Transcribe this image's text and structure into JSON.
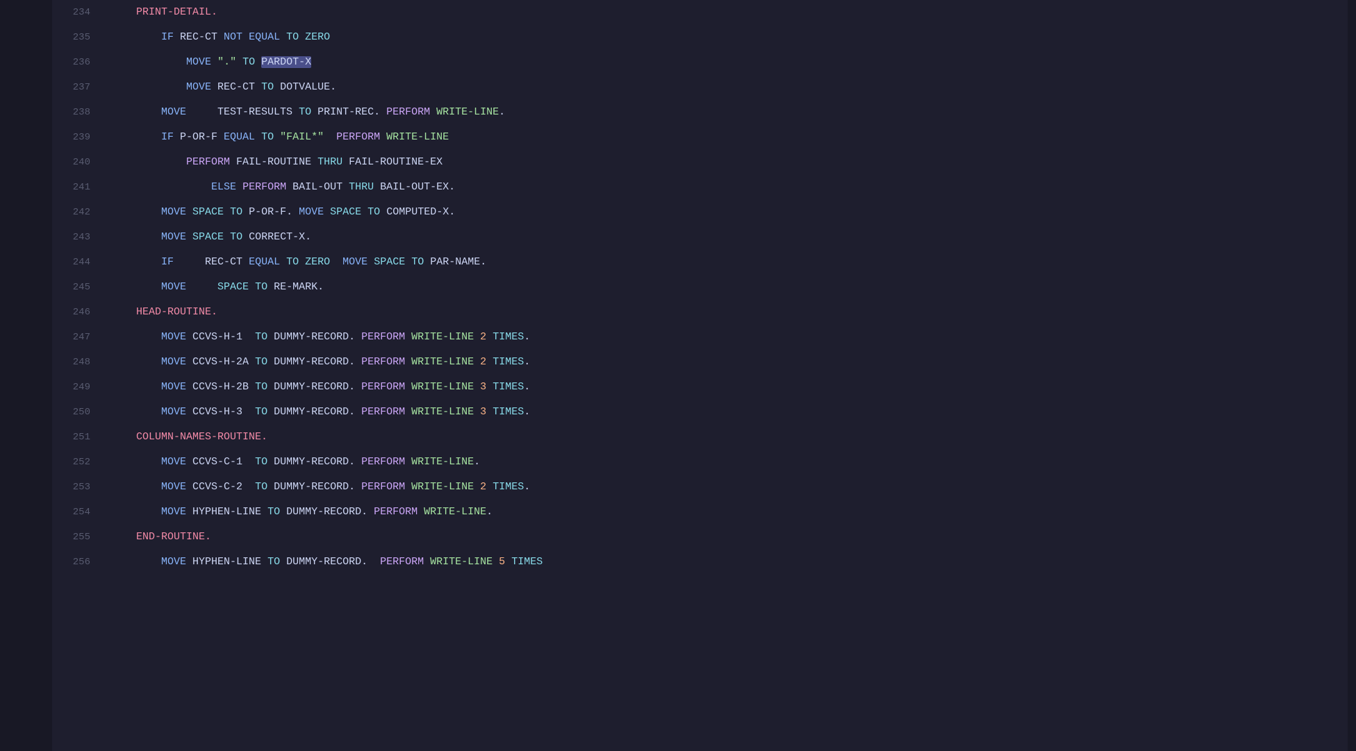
{
  "editor": {
    "background": "#1e1e2e",
    "lines": [
      {
        "number": "234",
        "tokens": [
          {
            "text": "    PRINT-DETAIL.",
            "class": "label"
          }
        ]
      },
      {
        "number": "235",
        "tokens": [
          {
            "text": "        ",
            "class": ""
          },
          {
            "text": "IF",
            "class": "kw-if"
          },
          {
            "text": " REC-CT ",
            "class": "var"
          },
          {
            "text": "NOT",
            "class": "kw-not"
          },
          {
            "text": " ",
            "class": ""
          },
          {
            "text": "EQUAL",
            "class": "kw-equal"
          },
          {
            "text": " ",
            "class": ""
          },
          {
            "text": "TO",
            "class": "kw-to"
          },
          {
            "text": " ",
            "class": ""
          },
          {
            "text": "ZERO",
            "class": "kw-zero"
          }
        ]
      },
      {
        "number": "236",
        "tokens": [
          {
            "text": "            ",
            "class": ""
          },
          {
            "text": "MOVE",
            "class": "kw-move"
          },
          {
            "text": " ",
            "class": ""
          },
          {
            "text": "\".\"",
            "class": "str"
          },
          {
            "text": " ",
            "class": ""
          },
          {
            "text": "TO",
            "class": "kw-to"
          },
          {
            "text": " ",
            "class": ""
          },
          {
            "text": "PARDOT-X",
            "class": "var highlight-selection"
          }
        ]
      },
      {
        "number": "237",
        "tokens": [
          {
            "text": "            ",
            "class": ""
          },
          {
            "text": "MOVE",
            "class": "kw-move"
          },
          {
            "text": " REC-CT ",
            "class": "var"
          },
          {
            "text": "TO",
            "class": "kw-to"
          },
          {
            "text": " DOTVALUE.",
            "class": "var"
          }
        ]
      },
      {
        "number": "238",
        "tokens": [
          {
            "text": "        ",
            "class": ""
          },
          {
            "text": "MOVE",
            "class": "kw-move"
          },
          {
            "text": "     TEST-RESULTS ",
            "class": "var"
          },
          {
            "text": "TO",
            "class": "kw-to"
          },
          {
            "text": " PRINT-REC. ",
            "class": "var"
          },
          {
            "text": "PERFORM",
            "class": "kw-perform"
          },
          {
            "text": " ",
            "class": ""
          },
          {
            "text": "WRITE-LINE",
            "class": "kw-write-line"
          },
          {
            "text": ".",
            "class": "punct"
          }
        ]
      },
      {
        "number": "239",
        "tokens": [
          {
            "text": "        ",
            "class": ""
          },
          {
            "text": "IF",
            "class": "kw-if"
          },
          {
            "text": " P-OR-F ",
            "class": "var"
          },
          {
            "text": "EQUAL",
            "class": "kw-equal"
          },
          {
            "text": " ",
            "class": ""
          },
          {
            "text": "TO",
            "class": "kw-to"
          },
          {
            "text": " ",
            "class": ""
          },
          {
            "text": "\"FAIL*\"",
            "class": "str"
          },
          {
            "text": "  ",
            "class": ""
          },
          {
            "text": "PERFORM",
            "class": "kw-perform"
          },
          {
            "text": " ",
            "class": ""
          },
          {
            "text": "WRITE-LINE",
            "class": "kw-write-line"
          }
        ]
      },
      {
        "number": "240",
        "tokens": [
          {
            "text": "            ",
            "class": ""
          },
          {
            "text": "PERFORM",
            "class": "kw-perform"
          },
          {
            "text": " FAIL-ROUTINE ",
            "class": "var"
          },
          {
            "text": "THRU",
            "class": "kw-thru"
          },
          {
            "text": " FAIL-ROUTINE-EX",
            "class": "var"
          }
        ]
      },
      {
        "number": "241",
        "tokens": [
          {
            "text": "                ",
            "class": ""
          },
          {
            "text": "ELSE",
            "class": "kw-else"
          },
          {
            "text": " ",
            "class": ""
          },
          {
            "text": "PERFORM",
            "class": "kw-perform"
          },
          {
            "text": " BAIL-OUT ",
            "class": "var"
          },
          {
            "text": "THRU",
            "class": "kw-thru"
          },
          {
            "text": " BAIL-OUT-EX.",
            "class": "var"
          }
        ]
      },
      {
        "number": "242",
        "tokens": [
          {
            "text": "        ",
            "class": ""
          },
          {
            "text": "MOVE",
            "class": "kw-move"
          },
          {
            "text": " ",
            "class": ""
          },
          {
            "text": "SPACE",
            "class": "kw-space"
          },
          {
            "text": " ",
            "class": ""
          },
          {
            "text": "TO",
            "class": "kw-to"
          },
          {
            "text": " P-OR-F. ",
            "class": "var"
          },
          {
            "text": "MOVE",
            "class": "kw-move"
          },
          {
            "text": " ",
            "class": ""
          },
          {
            "text": "SPACE",
            "class": "kw-space"
          },
          {
            "text": " ",
            "class": ""
          },
          {
            "text": "TO",
            "class": "kw-to"
          },
          {
            "text": " COMPUTED-X.",
            "class": "var"
          }
        ]
      },
      {
        "number": "243",
        "tokens": [
          {
            "text": "        ",
            "class": ""
          },
          {
            "text": "MOVE",
            "class": "kw-move"
          },
          {
            "text": " ",
            "class": ""
          },
          {
            "text": "SPACE",
            "class": "kw-space"
          },
          {
            "text": " ",
            "class": ""
          },
          {
            "text": "TO",
            "class": "kw-to"
          },
          {
            "text": " CORRECT-X.",
            "class": "var"
          }
        ]
      },
      {
        "number": "244",
        "tokens": [
          {
            "text": "        ",
            "class": ""
          },
          {
            "text": "IF",
            "class": "kw-if"
          },
          {
            "text": "     REC-CT ",
            "class": "var"
          },
          {
            "text": "EQUAL",
            "class": "kw-equal"
          },
          {
            "text": " ",
            "class": ""
          },
          {
            "text": "TO",
            "class": "kw-to"
          },
          {
            "text": " ",
            "class": ""
          },
          {
            "text": "ZERO",
            "class": "kw-zero"
          },
          {
            "text": "  ",
            "class": ""
          },
          {
            "text": "MOVE",
            "class": "kw-move"
          },
          {
            "text": " ",
            "class": ""
          },
          {
            "text": "SPACE",
            "class": "kw-space"
          },
          {
            "text": " ",
            "class": ""
          },
          {
            "text": "TO",
            "class": "kw-to"
          },
          {
            "text": " PAR-NAME.",
            "class": "var"
          }
        ]
      },
      {
        "number": "245",
        "tokens": [
          {
            "text": "        ",
            "class": ""
          },
          {
            "text": "MOVE",
            "class": "kw-move"
          },
          {
            "text": "     ",
            "class": ""
          },
          {
            "text": "SPACE",
            "class": "kw-space"
          },
          {
            "text": " ",
            "class": ""
          },
          {
            "text": "TO",
            "class": "kw-to"
          },
          {
            "text": " RE-MARK.",
            "class": "var"
          }
        ]
      },
      {
        "number": "246",
        "tokens": [
          {
            "text": "    HEAD-ROUTINE.",
            "class": "label"
          }
        ]
      },
      {
        "number": "247",
        "tokens": [
          {
            "text": "        ",
            "class": ""
          },
          {
            "text": "MOVE",
            "class": "kw-move"
          },
          {
            "text": " CCVS-H-1  ",
            "class": "var"
          },
          {
            "text": "TO",
            "class": "kw-to"
          },
          {
            "text": " DUMMY-RECORD. ",
            "class": "var"
          },
          {
            "text": "PERFORM",
            "class": "kw-perform"
          },
          {
            "text": " ",
            "class": ""
          },
          {
            "text": "WRITE-LINE",
            "class": "kw-write-line"
          },
          {
            "text": " ",
            "class": ""
          },
          {
            "text": "2",
            "class": "kw-number"
          },
          {
            "text": " ",
            "class": ""
          },
          {
            "text": "TIMES",
            "class": "kw-times"
          },
          {
            "text": ".",
            "class": "punct"
          }
        ]
      },
      {
        "number": "248",
        "tokens": [
          {
            "text": "        ",
            "class": ""
          },
          {
            "text": "MOVE",
            "class": "kw-move"
          },
          {
            "text": " CCVS-H-2A ",
            "class": "var"
          },
          {
            "text": "TO",
            "class": "kw-to"
          },
          {
            "text": " DUMMY-RECORD. ",
            "class": "var"
          },
          {
            "text": "PERFORM",
            "class": "kw-perform"
          },
          {
            "text": " ",
            "class": ""
          },
          {
            "text": "WRITE-LINE",
            "class": "kw-write-line"
          },
          {
            "text": " ",
            "class": ""
          },
          {
            "text": "2",
            "class": "kw-number"
          },
          {
            "text": " ",
            "class": ""
          },
          {
            "text": "TIMES",
            "class": "kw-times"
          },
          {
            "text": ".",
            "class": "punct"
          }
        ]
      },
      {
        "number": "249",
        "tokens": [
          {
            "text": "        ",
            "class": ""
          },
          {
            "text": "MOVE",
            "class": "kw-move"
          },
          {
            "text": " CCVS-H-2B ",
            "class": "var"
          },
          {
            "text": "TO",
            "class": "kw-to"
          },
          {
            "text": " DUMMY-RECORD. ",
            "class": "var"
          },
          {
            "text": "PERFORM",
            "class": "kw-perform"
          },
          {
            "text": " ",
            "class": ""
          },
          {
            "text": "WRITE-LINE",
            "class": "kw-write-line"
          },
          {
            "text": " ",
            "class": ""
          },
          {
            "text": "3",
            "class": "kw-number"
          },
          {
            "text": " ",
            "class": ""
          },
          {
            "text": "TIMES",
            "class": "kw-times"
          },
          {
            "text": ".",
            "class": "punct"
          }
        ]
      },
      {
        "number": "250",
        "tokens": [
          {
            "text": "        ",
            "class": ""
          },
          {
            "text": "MOVE",
            "class": "kw-move"
          },
          {
            "text": " CCVS-H-3  ",
            "class": "var"
          },
          {
            "text": "TO",
            "class": "kw-to"
          },
          {
            "text": " DUMMY-RECORD. ",
            "class": "var"
          },
          {
            "text": "PERFORM",
            "class": "kw-perform"
          },
          {
            "text": " ",
            "class": ""
          },
          {
            "text": "WRITE-LINE",
            "class": "kw-write-line"
          },
          {
            "text": " ",
            "class": ""
          },
          {
            "text": "3",
            "class": "kw-number"
          },
          {
            "text": " ",
            "class": ""
          },
          {
            "text": "TIMES",
            "class": "kw-times"
          },
          {
            "text": ".",
            "class": "punct"
          }
        ]
      },
      {
        "number": "251",
        "tokens": [
          {
            "text": "    COLUMN-NAMES-ROUTINE.",
            "class": "label"
          }
        ]
      },
      {
        "number": "252",
        "tokens": [
          {
            "text": "        ",
            "class": ""
          },
          {
            "text": "MOVE",
            "class": "kw-move"
          },
          {
            "text": " CCVS-C-1  ",
            "class": "var"
          },
          {
            "text": "TO",
            "class": "kw-to"
          },
          {
            "text": " DUMMY-RECORD. ",
            "class": "var"
          },
          {
            "text": "PERFORM",
            "class": "kw-perform"
          },
          {
            "text": " ",
            "class": ""
          },
          {
            "text": "WRITE-LINE",
            "class": "kw-write-line"
          },
          {
            "text": ".",
            "class": "punct"
          }
        ]
      },
      {
        "number": "253",
        "tokens": [
          {
            "text": "        ",
            "class": ""
          },
          {
            "text": "MOVE",
            "class": "kw-move"
          },
          {
            "text": " CCVS-C-2  ",
            "class": "var"
          },
          {
            "text": "TO",
            "class": "kw-to"
          },
          {
            "text": " DUMMY-RECORD. ",
            "class": "var"
          },
          {
            "text": "PERFORM",
            "class": "kw-perform"
          },
          {
            "text": " ",
            "class": ""
          },
          {
            "text": "WRITE-LINE",
            "class": "kw-write-line"
          },
          {
            "text": " ",
            "class": ""
          },
          {
            "text": "2",
            "class": "kw-number"
          },
          {
            "text": " ",
            "class": ""
          },
          {
            "text": "TIMES",
            "class": "kw-times"
          },
          {
            "text": ".",
            "class": "punct"
          }
        ]
      },
      {
        "number": "254",
        "tokens": [
          {
            "text": "        ",
            "class": ""
          },
          {
            "text": "MOVE",
            "class": "kw-move"
          },
          {
            "text": " HYPHEN-LINE ",
            "class": "var"
          },
          {
            "text": "TO",
            "class": "kw-to"
          },
          {
            "text": " DUMMY-RECORD. ",
            "class": "var"
          },
          {
            "text": "PERFORM",
            "class": "kw-perform"
          },
          {
            "text": " ",
            "class": ""
          },
          {
            "text": "WRITE-LINE",
            "class": "kw-write-line"
          },
          {
            "text": ".",
            "class": "punct"
          }
        ]
      },
      {
        "number": "255",
        "tokens": [
          {
            "text": "    END-ROUTINE.",
            "class": "label"
          }
        ]
      },
      {
        "number": "256",
        "tokens": [
          {
            "text": "        ",
            "class": ""
          },
          {
            "text": "MOVE",
            "class": "kw-move"
          },
          {
            "text": " HYPHEN-LINE ",
            "class": "var"
          },
          {
            "text": "TO",
            "class": "kw-to"
          },
          {
            "text": " DUMMY-RECORD.  ",
            "class": "var"
          },
          {
            "text": "PERFORM",
            "class": "kw-perform"
          },
          {
            "text": " ",
            "class": ""
          },
          {
            "text": "WRITE-LINE",
            "class": "kw-write-line"
          },
          {
            "text": " ",
            "class": ""
          },
          {
            "text": "5",
            "class": "kw-number"
          },
          {
            "text": " ",
            "class": ""
          },
          {
            "text": "TIMES",
            "class": "kw-times"
          }
        ]
      }
    ]
  }
}
